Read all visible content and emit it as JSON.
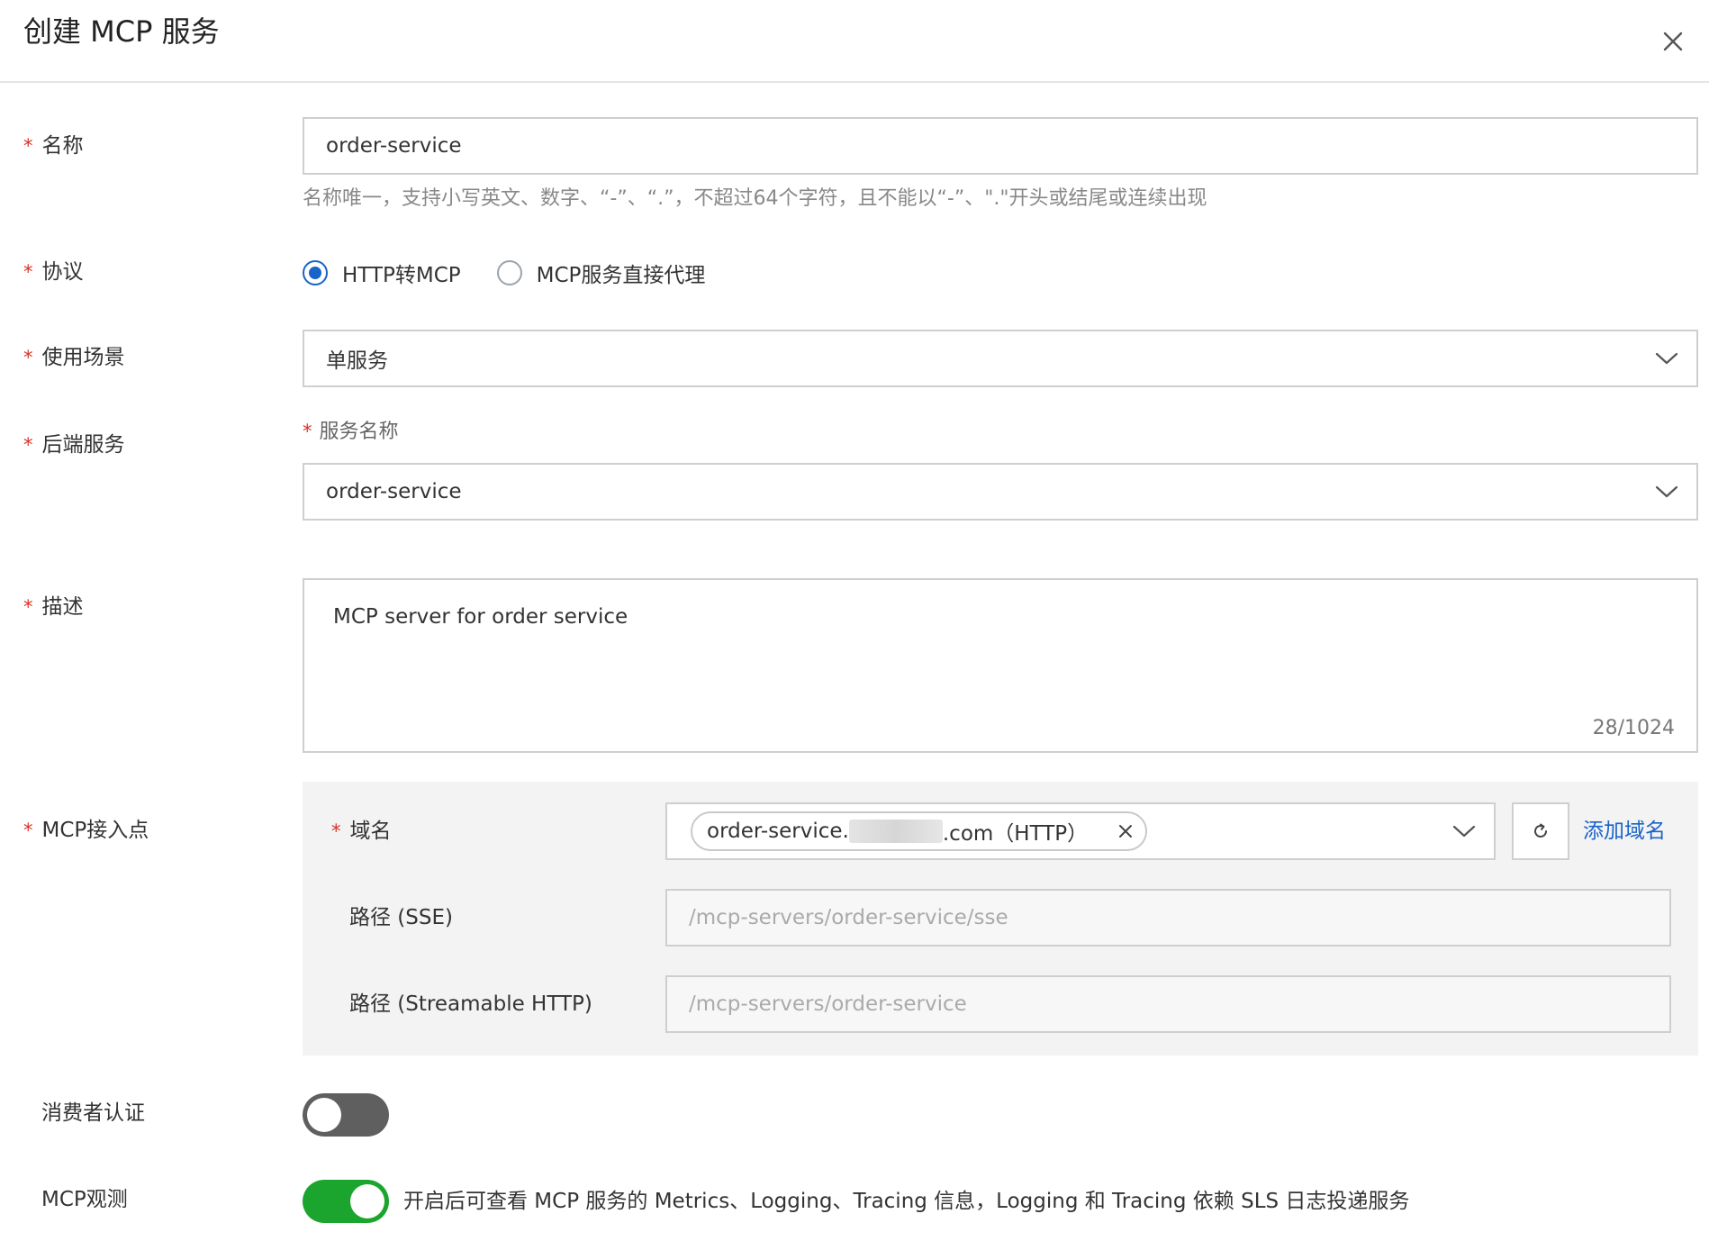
{
  "dialog": {
    "title": "创建 MCP 服务"
  },
  "form": {
    "name": {
      "label": "名称",
      "value": "order-service",
      "hint": "名称唯一，支持小写英文、数字、“-”、“.”，不超过64个字符，且不能以“-”、\".\"开头或结尾或连续出现"
    },
    "protocol": {
      "label": "协议",
      "options": [
        "HTTP转MCP",
        "MCP服务直接代理"
      ],
      "selected": "HTTP转MCP"
    },
    "scenario": {
      "label": "使用场景",
      "value": "单服务"
    },
    "backend": {
      "label": "后端服务",
      "sub_label": "服务名称",
      "value": "order-service"
    },
    "description": {
      "label": "描述",
      "value": "MCP server for order service",
      "counter": "28/1024"
    },
    "endpoint": {
      "label": "MCP接入点",
      "domain_label": "域名",
      "domain_tag_prefix": "order-service.",
      "domain_tag_suffix": ".com（HTTP）",
      "add_domain": "添加域名",
      "sse_label": "路径 (SSE)",
      "sse_placeholder": "/mcp-servers/order-service/sse",
      "http_label": "路径 (Streamable HTTP)",
      "http_placeholder": "/mcp-servers/order-service"
    },
    "consumer_auth": {
      "label": "消费者认证",
      "enabled": false
    },
    "observability": {
      "label": "MCP观测",
      "enabled": true,
      "note": "开启后可查看 MCP 服务的 Metrics、Logging、Tracing 信息，Logging 和 Tracing 依赖 SLS 日志投递服务"
    }
  },
  "colors": {
    "accent": "#1a63c9",
    "required": "#d93026",
    "switch_on": "#1ba52e",
    "switch_off": "#5f5f5f"
  },
  "icons": {
    "close": "close-icon",
    "select": "chevron-down-icon",
    "refresh": "refresh-icon",
    "tag_remove": "close-icon"
  }
}
